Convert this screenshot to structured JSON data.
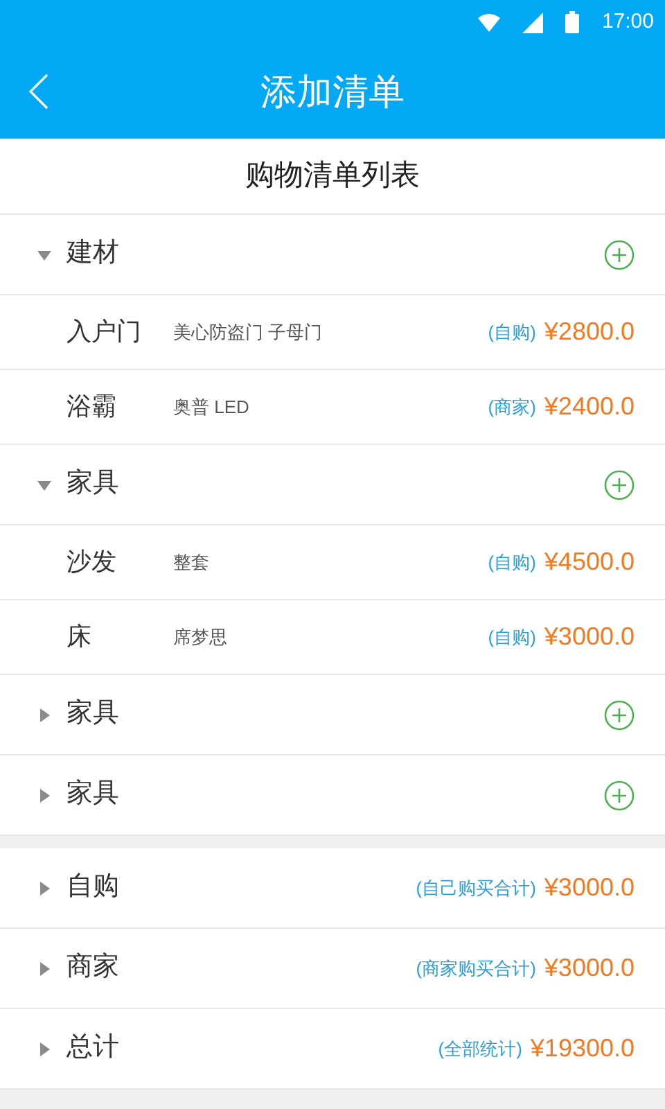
{
  "status_bar": {
    "time": "17:00"
  },
  "header": {
    "title": "添加清单"
  },
  "list_title": "购物清单列表",
  "groups": [
    {
      "name": "建材",
      "expanded": true,
      "items": [
        {
          "name": "入户门",
          "note": "美心防盗门 子母门",
          "source": "(自购)",
          "price": "¥2800.0"
        },
        {
          "name": "浴霸",
          "note": "奥普 LED",
          "source": "(商家)",
          "price": "¥2400.0"
        }
      ]
    },
    {
      "name": "家具",
      "expanded": true,
      "items": [
        {
          "name": "沙发",
          "note": "整套",
          "source": "(自购)",
          "price": "¥4500.0"
        },
        {
          "name": "床",
          "note": "席梦思",
          "source": "(自购)",
          "price": "¥3000.0"
        }
      ]
    },
    {
      "name": "家具",
      "expanded": false
    },
    {
      "name": "家具",
      "expanded": false
    }
  ],
  "summary": [
    {
      "name": "自购",
      "expanded": false,
      "note": "(自己购买合计)",
      "amount": "¥3000.0"
    },
    {
      "name": "商家",
      "expanded": false,
      "note": "(商家购买合计)",
      "amount": "¥3000.0"
    },
    {
      "name": "总计",
      "expanded": false,
      "note": "(全部统计)",
      "amount": "¥19300.0"
    }
  ]
}
